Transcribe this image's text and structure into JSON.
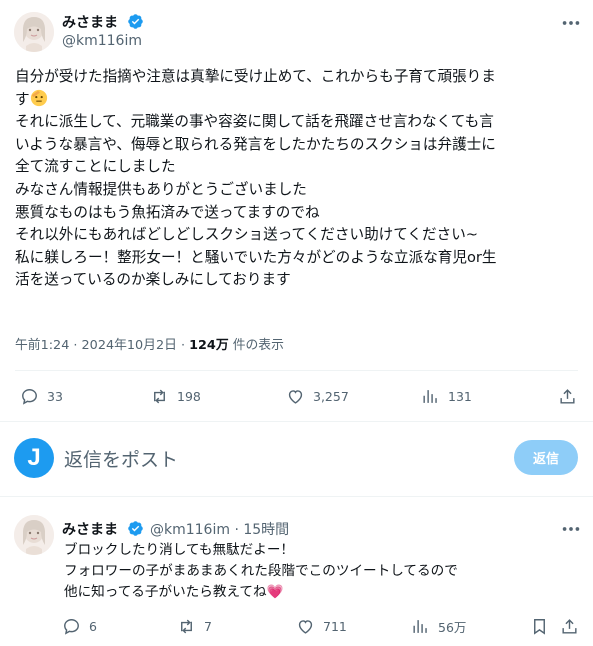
{
  "main_tweet": {
    "author_name": "みさまま",
    "author_handle": "@km116im",
    "body_lines": [
      "自分が受けた指摘や注意は真摯に受け止めて、これからも子育て頑張りま",
      "す",
      "それに派生して、元職業の事や容姿に関して話を飛躍させ言わなくても言",
      "いような暴言や、侮辱と取られる発言をしたかたちのスクショは弁護士に",
      "全て流すことにしました",
      "みなさん情報提供もありがとうございました",
      "悪質なものはもう魚拓済みで送ってますのでね",
      "それ以外にもあればどしどしスクショ送ってください助けてください~",
      "私に躾しろー！整形女ー！と騒いでいた方々がどのような立派な育児or生",
      "活を送っているのか楽しみにしております"
    ],
    "timestamp": "午前1:24 · 2024年10月2日 · ",
    "views_count": "124万",
    "views_label": " 件の表示",
    "replies": "33",
    "retweets": "198",
    "likes": "3,257",
    "bookmarks": "131"
  },
  "reply_composer": {
    "avatar_letter": "J",
    "placeholder": "返信をポスト",
    "button_label": "返信"
  },
  "reply_tweet": {
    "author_name": "みさまま",
    "author_handle": "@km116im",
    "time": "· 15時間",
    "body_lines": [
      "ブロックしたり消しても無駄だよー！",
      "フォロワーの子がまあまあくれた段階でこのツイートしてるので",
      "他に知ってる子がいたら教えてね"
    ],
    "heart_emoji": "💗",
    "replies": "6",
    "retweets": "7",
    "likes": "711",
    "views": "56万"
  },
  "colors": {
    "verified_blue": "#1d9bf0",
    "secondary_text": "#536471",
    "reply_button_disabled": "#8ecdf8"
  }
}
